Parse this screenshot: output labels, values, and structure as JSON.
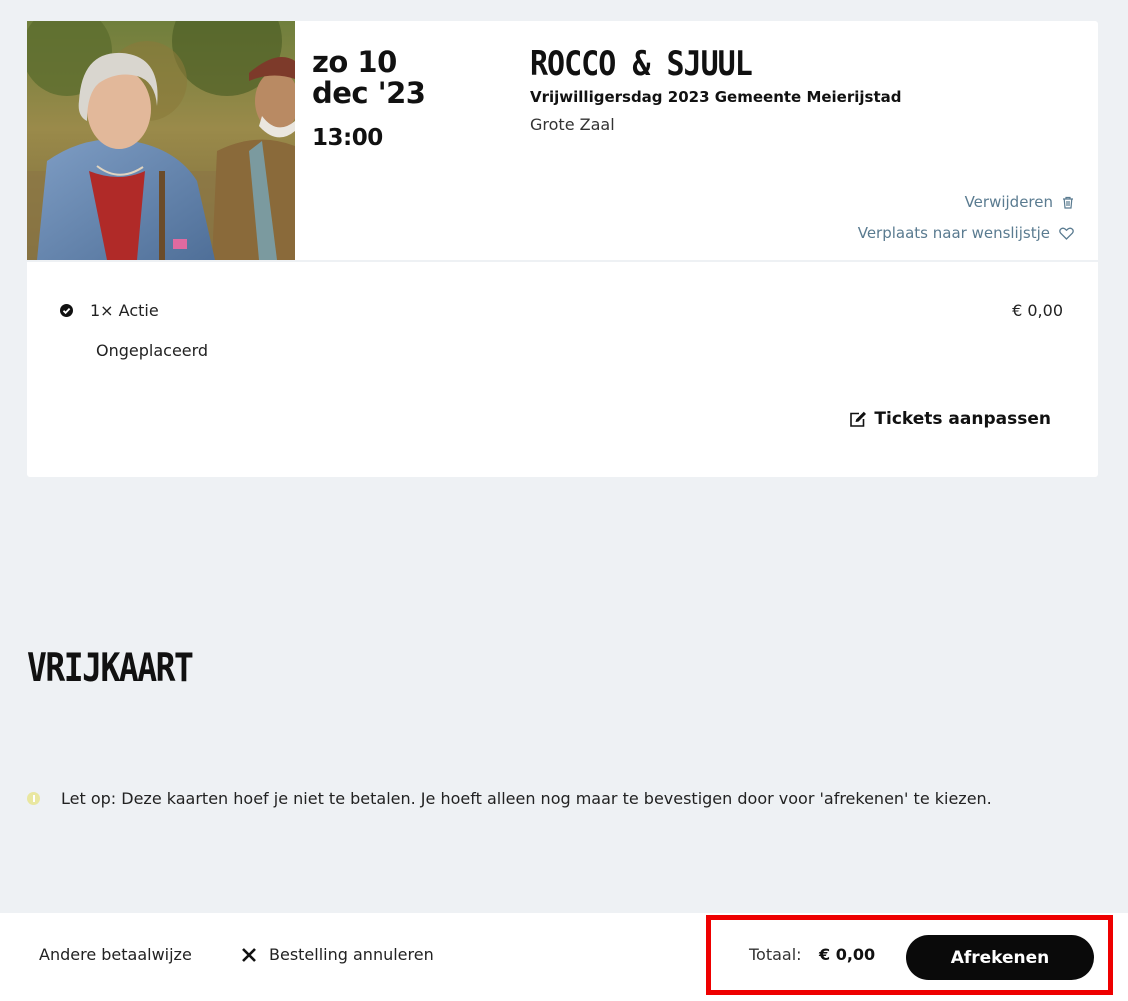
{
  "event": {
    "date_line1": "zo 10",
    "date_line2": "dec '23",
    "time": "13:00",
    "title": "ROCCO & SJUUL",
    "subtitle": "Vrijwilligersdag 2023 Gemeente Meierijstad",
    "venue": "Grote Zaal",
    "remove_label": "Verwijderen",
    "wishlist_label": "Verplaats naar wenslijstje",
    "image_icon": "poster-photo"
  },
  "ticket": {
    "description": "1× Actie",
    "price": "€ 0,00",
    "seat": "Ongeplaceerd",
    "edit_label": "Tickets aanpassen"
  },
  "section": {
    "title": "VRIJKAART",
    "notice": "Let op: Deze kaarten hoef je niet te betalen. Je hoeft alleen nog maar te bevestigen door voor 'afrekenen' te kiezen."
  },
  "footer": {
    "other_payment": "Andere betaalwijze",
    "cancel_order": "Bestelling annuleren",
    "total_label": "Totaal:",
    "total_value": "€ 0,00",
    "checkout_label": "Afrekenen"
  },
  "colors": {
    "background": "#eef1f4",
    "link": "#5a7b90",
    "button": "#0a0a0a",
    "highlight": "#ee0000",
    "info": "#e9e7a0"
  }
}
